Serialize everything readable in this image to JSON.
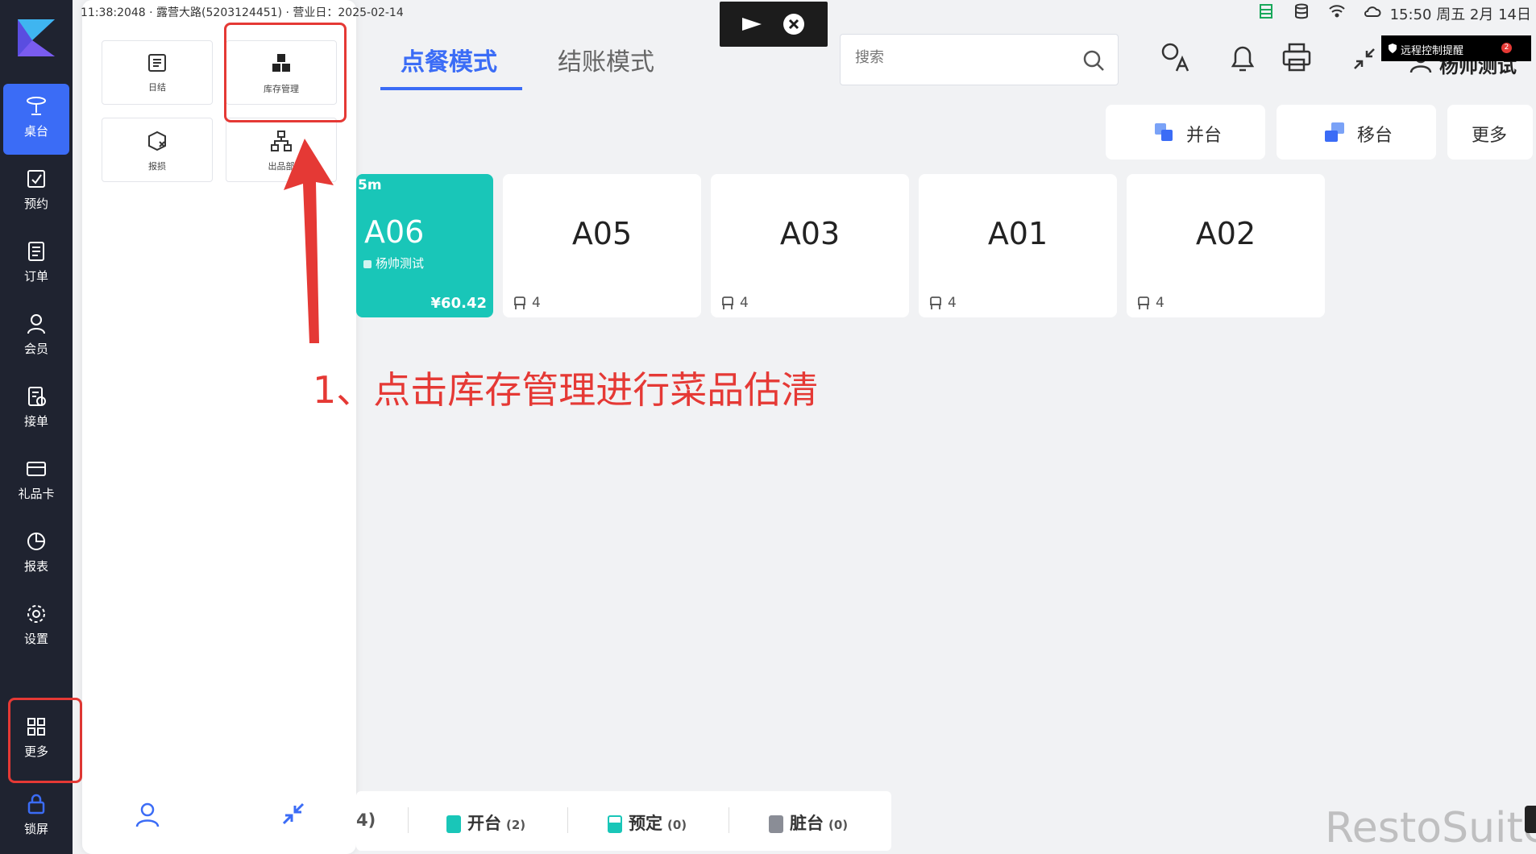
{
  "statusbar": {
    "left_text": "11:38:2048 · 露营大路(5203124451) · 营业日：2025-02-14",
    "clock": "15:50 周五 2月 14日"
  },
  "sidebar": {
    "items": [
      {
        "label": "桌台",
        "icon": "table-icon",
        "active": true
      },
      {
        "label": "预约",
        "icon": "calendar-check-icon"
      },
      {
        "label": "订单",
        "icon": "order-icon"
      },
      {
        "label": "会员",
        "icon": "member-icon"
      },
      {
        "label": "接单",
        "icon": "receive-order-icon"
      },
      {
        "label": "礼品卡",
        "icon": "gift-card-icon"
      },
      {
        "label": "报表",
        "icon": "report-icon"
      },
      {
        "label": "设置",
        "icon": "settings-icon"
      },
      {
        "label": "更多",
        "icon": "more-grid-icon"
      },
      {
        "label": "锁屏",
        "icon": "lock-icon"
      }
    ]
  },
  "drawer": {
    "tiles": [
      {
        "label": "日结",
        "icon": "daily-settlement-icon"
      },
      {
        "label": "库存管理",
        "icon": "inventory-icon"
      },
      {
        "label": "报损",
        "icon": "damage-report-icon"
      },
      {
        "label": "出品部",
        "icon": "kitchen-dept-icon"
      }
    ]
  },
  "tabs": [
    {
      "label": "点餐模式",
      "active": true
    },
    {
      "label": "结账模式",
      "active": false
    }
  ],
  "search": {
    "placeholder": "搜索"
  },
  "remote": {
    "text": "远程控制提醒",
    "badge": "2"
  },
  "user": {
    "name": "杨帅测试"
  },
  "actions": [
    {
      "label": "并台"
    },
    {
      "label": "移台"
    },
    {
      "label": "更多"
    }
  ],
  "tables": [
    {
      "name": "A06",
      "occupied": true,
      "time": "5m",
      "guest": "杨帅测试",
      "price": "¥60.42"
    },
    {
      "name": "A05",
      "occupied": false,
      "seats": "4"
    },
    {
      "name": "A03",
      "occupied": false,
      "seats": "4"
    },
    {
      "name": "A01",
      "occupied": false,
      "seats": "4"
    },
    {
      "name": "A02",
      "occupied": false,
      "seats": "4"
    }
  ],
  "annotation": "1、点击库存管理进行菜品估清",
  "legend": {
    "first_count": "4)",
    "items": [
      {
        "label": "开台",
        "count": "(2)",
        "color": "#19c6b8"
      },
      {
        "label": "预定",
        "count": "(0)",
        "color": "#19c6b8"
      },
      {
        "label": "脏台",
        "count": "(0)",
        "color": "#8a8d96"
      }
    ]
  },
  "watermark": "RestoSuite",
  "colors": {
    "accent": "#3b6cf6",
    "occupied": "#19c6b8",
    "highlight": "#e53935"
  }
}
